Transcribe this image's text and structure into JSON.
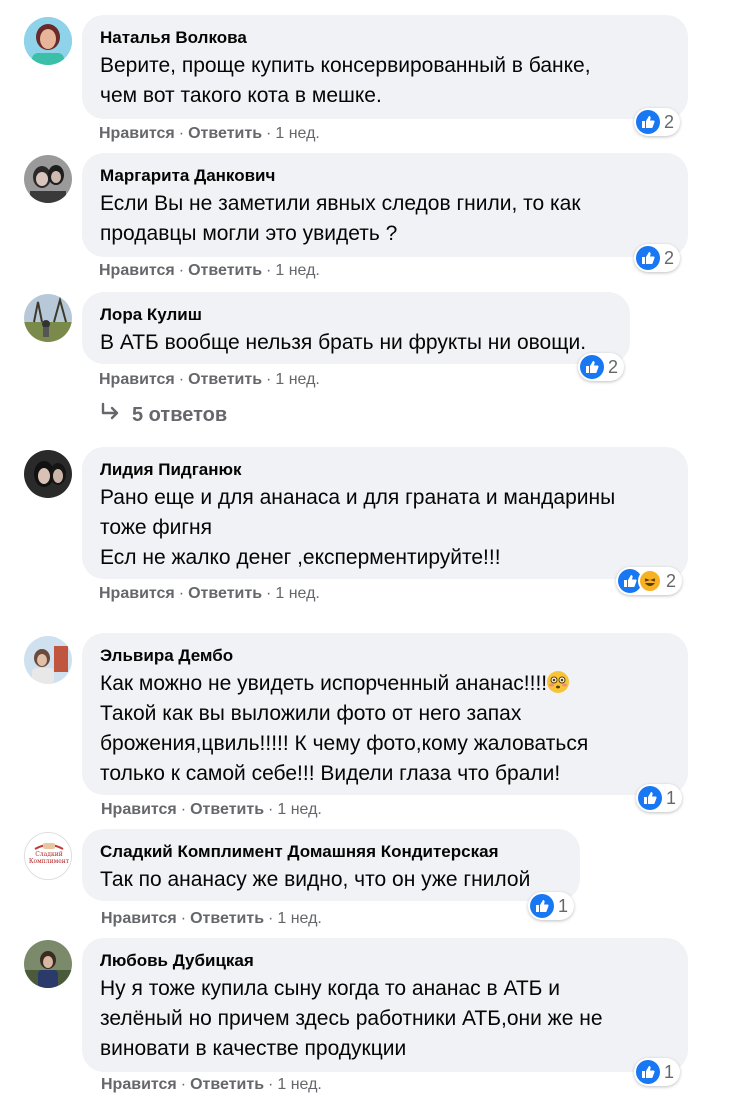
{
  "comments": [
    {
      "author": "Наталья Волкова",
      "text": "Верите, проще купить консервированный в банке,\nчем вот такого кота в мешке.",
      "like_label": "Нравится",
      "reply_label": "Ответить",
      "time": "1 нед.",
      "reaction_count": "2"
    },
    {
      "author": "Маргарита Данкович",
      "text": "Если Вы не заметили явных следов гнили, то как\nпродавцы могли это увидеть ?",
      "like_label": "Нравится",
      "reply_label": "Ответить",
      "time": "1 нед.",
      "reaction_count": "2"
    },
    {
      "author": "Лора Кулиш",
      "text": "В АТБ вообще нельзя брать ни фрукты ни овощи.",
      "like_label": "Нравится",
      "reply_label": "Ответить",
      "time": "1 нед.",
      "reaction_count": "2"
    },
    {
      "author": "Лидия Пидганюк",
      "text": "Рано еще и для ананаса и для граната и мандарины\nтоже фигня\nЕсл не жалко денег ,експерментируйте!!!",
      "like_label": "Нравится",
      "reply_label": "Ответить",
      "time": "1 нед.",
      "reaction_count": "2"
    },
    {
      "author": "Эльвира Дембо",
      "text_line1": "Как можно не увидеть испорченный ананас!!!!",
      "text_rest": "Такой как вы выложили фото от него запах\nброжения,цвиль!!!!! К чему фото,кому жаловаться\nтолько к самой себе!!! Видели глаза что брали!",
      "like_label": "Нравится",
      "reply_label": "Ответить",
      "time": "1 нед.",
      "reaction_count": "1"
    },
    {
      "author": "Сладкий Комплимент Домашняя Кондитерская",
      "text": "Так по ананасу же видно, что он уже гнилой",
      "like_label": "Нравится",
      "reply_label": "Ответить",
      "time": "1 нед.",
      "reaction_count": "1",
      "avatar_text": "Сладкий Комплимент"
    },
    {
      "author": "Любовь Дубицкая",
      "text": "Ну я тоже купила сыну когда то ананас в АТБ и\nзелёный но причем здесь работники АТБ,они же не\nвиновати в качестве продукции",
      "like_label": "Нравится",
      "reply_label": "Ответить",
      "time": "1 нед.",
      "reaction_count": "1"
    }
  ],
  "replies_link": "5 ответов",
  "colors": {
    "bubble": "#f0f2f5",
    "meta": "#65676b",
    "like_blue": "#1877f2",
    "haha_yellow": "#f7b125"
  }
}
